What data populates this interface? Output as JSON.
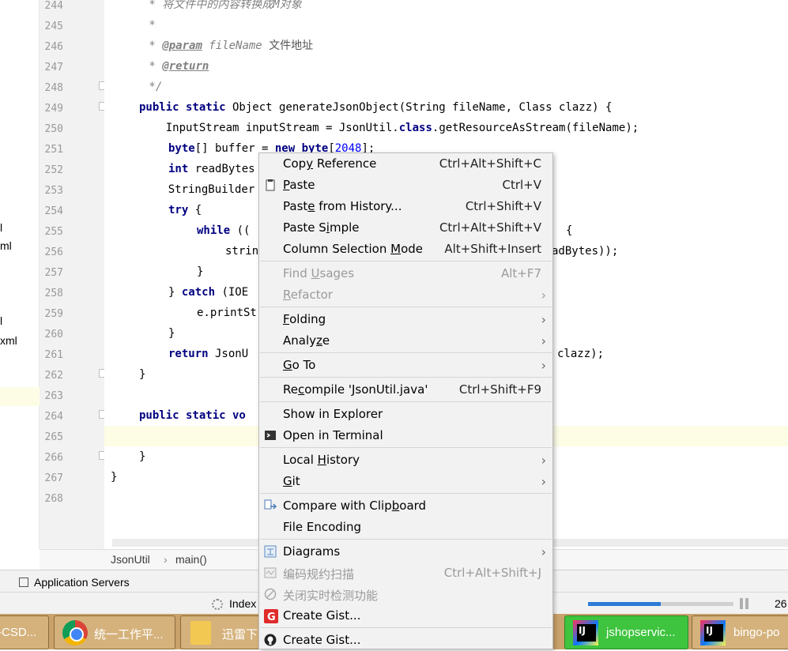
{
  "project_panel": {
    "fragments": [
      "l",
      "ml",
      "l",
      "xml"
    ]
  },
  "gutter": {
    "line_numbers": [
      "244",
      "245",
      "246",
      "247",
      "248",
      "249",
      "250",
      "251",
      "252",
      "253",
      "254",
      "255",
      "256",
      "257",
      "258",
      "259",
      "260",
      "261",
      "262",
      "263",
      "264",
      "265",
      "266",
      "267",
      "268"
    ]
  },
  "editor": {
    "line_244_comment": " * 将文件中的内容转换成M对象",
    "line_245_comment": " *",
    "line_246_prefix": " * ",
    "line_246_tag": "@param",
    "line_246_param": " fileName",
    "line_246_desc": " 文件地址",
    "line_247_prefix": " * ",
    "line_247_tag": "@return",
    "line_248_comment": " */",
    "line_249_kw": "public static",
    "line_249_rest": " Object generateJsonObject(String fileName, Class clazz) {",
    "line_250_pre": "    InputStream inputStream = JsonUtil.",
    "line_250_kw": "class",
    "line_250_post": ".getResourceAsStream(fileName);",
    "line_251_kw1": "byte",
    "line_251_mid": "[] buffer = ",
    "line_251_kw2": "new byte",
    "line_251_br1": "[",
    "line_251_num": "2048",
    "line_251_br2": "];",
    "line_252_kw": "int",
    "line_252_rest": " readBytes",
    "line_253_text": "    StringBuilder",
    "line_254_kw": "try",
    "line_254_rest": " {",
    "line_255_kw": "while",
    "line_255_rest": " ((",
    "line_255_tail": "{",
    "line_256_text": "strin",
    "line_256_tail": "adBytes));",
    "line_257_text": "}",
    "line_258_pre": "} ",
    "line_258_kw": "catch",
    "line_258_rest": " (IOE",
    "line_259_text": "e.printSt",
    "line_260_text": "}",
    "line_261_kw": "return",
    "line_261_rest": " JsonU",
    "line_261_tail": "clazz);",
    "line_262_text": "}",
    "line_264_kw": "public static",
    "line_264_rest": " vo",
    "line_266_text": "}",
    "line_267_text": "}"
  },
  "breadcrumb": {
    "class_name": "JsonUtil",
    "separator": "›",
    "method_name": "main()"
  },
  "tool_windows": {
    "application_servers": "Application Servers"
  },
  "status_bar": {
    "indexing_label": "Index",
    "progress": 0.5,
    "position_text": "26"
  },
  "taskbar": {
    "items": [
      {
        "label": "-CSD..."
      },
      {
        "label": "统一工作平..."
      },
      {
        "label": "迅雷下"
      },
      {
        "label": "jshopservic..."
      },
      {
        "label": "bingo-po"
      }
    ]
  },
  "context_menu": {
    "copy_reference": {
      "pre": "Cop",
      "u": "y",
      "post": " Reference",
      "shortcut": "Ctrl+Alt+Shift+C"
    },
    "paste": {
      "pre": "",
      "u": "P",
      "post": "aste",
      "shortcut": "Ctrl+V"
    },
    "paste_from_history": {
      "pre": "Past",
      "u": "e",
      "post": " from History...",
      "shortcut": "Ctrl+Shift+V"
    },
    "paste_simple": {
      "pre": "Paste S",
      "u": "i",
      "post": "mple",
      "shortcut": "Ctrl+Alt+Shift+V"
    },
    "column_selection_mode": {
      "pre": "Column Selection ",
      "u": "M",
      "post": "ode",
      "shortcut": "Alt+Shift+Insert"
    },
    "find_usages": {
      "pre": "Find ",
      "u": "U",
      "post": "sages",
      "shortcut": "Alt+F7"
    },
    "refactor": {
      "pre": "",
      "u": "R",
      "post": "efactor"
    },
    "folding": {
      "pre": "",
      "u": "F",
      "post": "olding"
    },
    "analyze": {
      "pre": "Analy",
      "u": "z",
      "post": "e"
    },
    "go_to": {
      "pre": "",
      "u": "G",
      "post": "o To"
    },
    "recompile": {
      "pre": "Re",
      "u": "c",
      "post": "ompile 'JsonUtil.java'",
      "shortcut": "Ctrl+Shift+F9"
    },
    "show_in_explorer": {
      "label": "Show in Explorer"
    },
    "open_in_terminal": {
      "label": "Open in Terminal"
    },
    "local_history": {
      "pre": "Local ",
      "u": "H",
      "post": "istory"
    },
    "git": {
      "pre": "",
      "u": "G",
      "post": "it"
    },
    "compare_with_clipboard": {
      "pre": "Compare with Clip",
      "u": "b",
      "post": "oard"
    },
    "file_encoding": {
      "label": "File Encoding"
    },
    "diagrams": {
      "label": "Diagrams"
    },
    "code_scan": {
      "label": "编码规约扫描",
      "shortcut": "Ctrl+Alt+Shift+J"
    },
    "close_realtime": {
      "label": "关闭实时检测功能"
    },
    "create_gist_1": {
      "label": "Create Gist..."
    },
    "create_gist_2": {
      "label": "Create Gist..."
    }
  },
  "colors": {
    "keyword": "#000080",
    "comment": "#808080",
    "number": "#0000ff",
    "caret_line": "#fdfde6",
    "progress": "#2b7bd6",
    "taskbar_active": "#3ec43e"
  }
}
